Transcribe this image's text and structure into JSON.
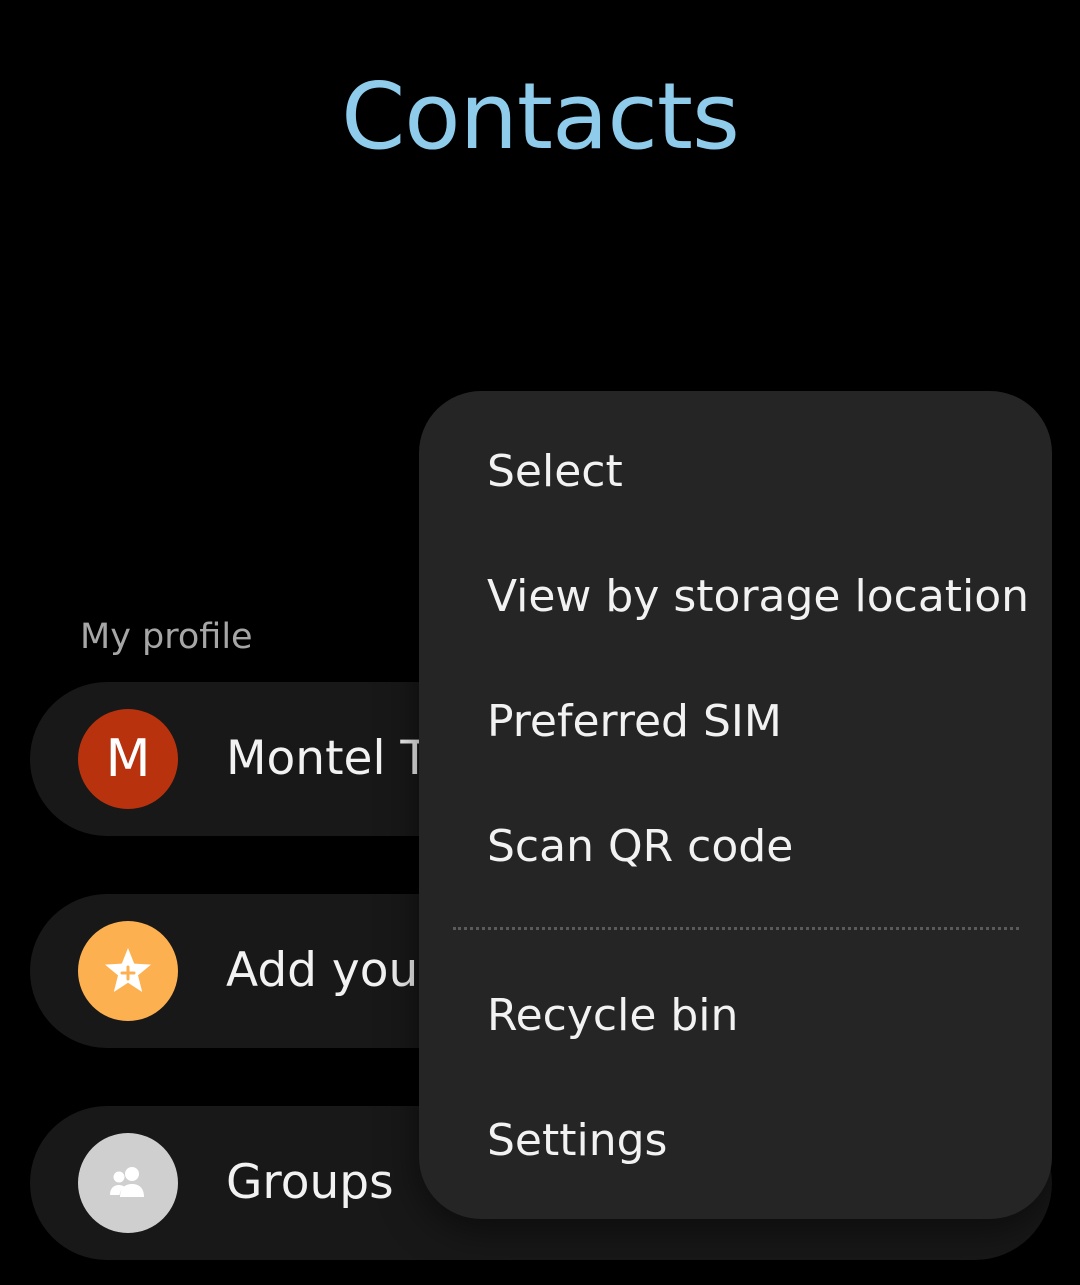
{
  "header": {
    "title": "Contacts"
  },
  "profile_section": {
    "label": "My profile",
    "name": "Montel To",
    "avatar_letter": "M"
  },
  "favorites": {
    "label": "Add your",
    "icon": "star-plus-icon"
  },
  "groups": {
    "label": "Groups",
    "icon": "people-icon"
  },
  "overflow_menu": {
    "items": [
      "Select",
      "View by storage location",
      "Preferred SIM",
      "Scan QR code",
      "Recycle bin",
      "Settings"
    ]
  },
  "colors": {
    "title": "#8fcbea",
    "background": "#000000",
    "card": "#181818",
    "menu": "#252525",
    "profile_avatar": "#b8320e",
    "favorites_avatar": "#fdb04f",
    "groups_avatar": "#cfcfcf",
    "section_label": "#a6a6a6"
  }
}
